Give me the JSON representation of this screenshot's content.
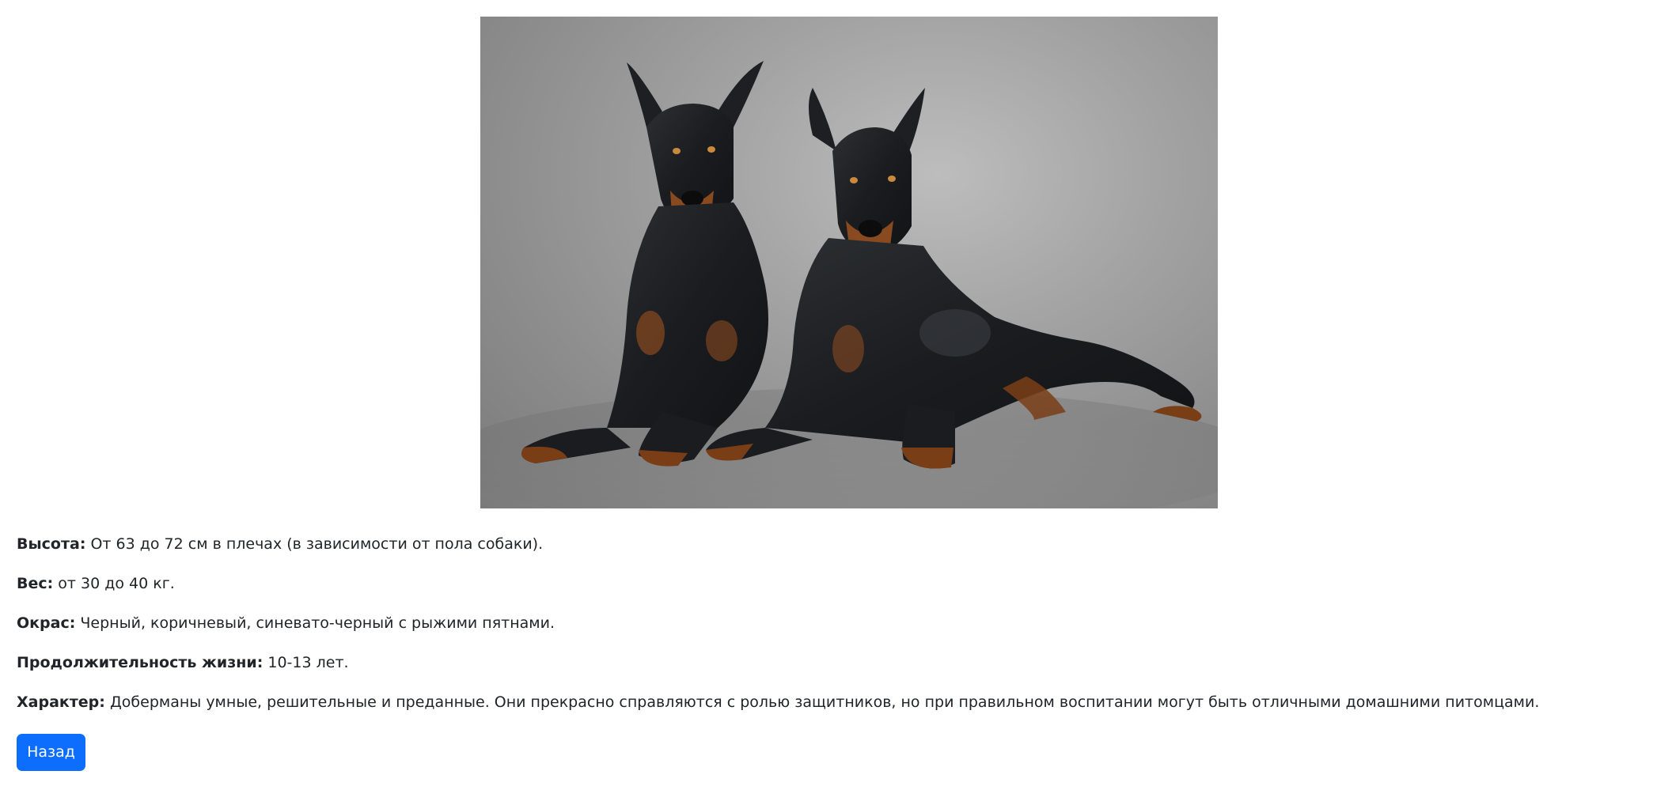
{
  "photo": {
    "subject": "two doberman dogs lying on grey studio background"
  },
  "details": [
    {
      "label": "Высота:",
      "value": "От 63 до 72 см в плечах (в зависимости от пола собаки)."
    },
    {
      "label": "Вес:",
      "value": "от 30 до 40 кг."
    },
    {
      "label": "Окрас:",
      "value": "Черный, коричневый, синевато-черный с рыжими пятнами."
    },
    {
      "label": "Продолжительность жизни:",
      "value": "10-13 лет."
    },
    {
      "label": "Характер:",
      "value": "Доберманы умные, решительные и преданные. Они прекрасно справляются с ролью защитников, но при правильном воспитании могут быть отличными домашними питомцами."
    }
  ],
  "back_button": {
    "label": "Назад"
  },
  "colors": {
    "primary": "#0d6efd",
    "text": "#212529"
  }
}
